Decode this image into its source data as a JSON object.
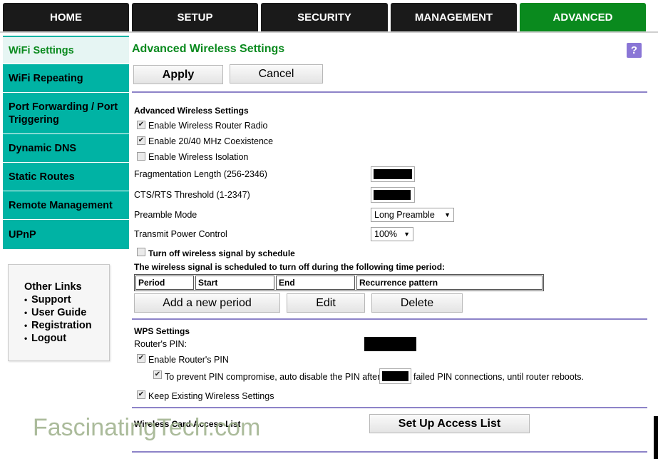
{
  "tabs": [
    {
      "label": "HOME"
    },
    {
      "label": "SETUP"
    },
    {
      "label": "SECURITY"
    },
    {
      "label": "MANAGEMENT"
    },
    {
      "label": "ADVANCED",
      "active": true
    }
  ],
  "sidebar": {
    "items": [
      {
        "label": "WiFi Settings",
        "active": true
      },
      {
        "label": "WiFi Repeating"
      },
      {
        "label": "Port Forwarding / Port Triggering"
      },
      {
        "label": "Dynamic DNS"
      },
      {
        "label": "Static Routes"
      },
      {
        "label": "Remote Management"
      },
      {
        "label": "UPnP"
      }
    ]
  },
  "other_links": {
    "title": "Other Links",
    "items": [
      "Support",
      "User Guide",
      "Registration",
      "Logout"
    ]
  },
  "main": {
    "title": "Advanced Wireless Settings",
    "help_label": "?",
    "apply_label": "Apply",
    "cancel_label": "Cancel",
    "advanced": {
      "heading": "Advanced Wireless Settings",
      "enable_radio": {
        "label": "Enable Wireless Router Radio",
        "checked": true
      },
      "coexistence": {
        "label": "Enable 20/40 MHz Coexistence",
        "checked": true
      },
      "isolation": {
        "label": "Enable Wireless Isolation",
        "checked": false
      },
      "frag_label": "Fragmentation Length (256-2346)",
      "cts_label": "CTS/RTS Threshold (1-2347)",
      "preamble_label": "Preamble Mode",
      "preamble_value": "Long Preamble",
      "power_label": "Transmit Power Control",
      "power_value": "100%"
    },
    "schedule": {
      "toggle_label": "Turn off wireless signal by schedule",
      "toggle_checked": false,
      "description": "The wireless signal is scheduled to turn off during the following time period:",
      "columns": [
        "Period",
        "Start",
        "End",
        "Recurrence pattern"
      ],
      "add_label": "Add a new period",
      "edit_label": "Edit",
      "delete_label": "Delete"
    },
    "wps": {
      "heading": "WPS Settings",
      "pin_label": "Router's PIN:",
      "enable_pin": {
        "label": "Enable Router's PIN",
        "checked": true
      },
      "prevent_before": "To prevent PIN compromise, auto disable the PIN after",
      "prevent_after": "failed PIN connections, until router reboots.",
      "prevent_checked": true,
      "keep": {
        "label": "Keep Existing Wireless Settings",
        "checked": true
      }
    },
    "access": {
      "label": "Wireless Card Access List",
      "button_label": "Set Up Access List"
    }
  },
  "watermark": "FascinatingTech.com",
  "colors": {
    "tab_bg": "#1a1a1a",
    "tab_active": "#0a8a1e",
    "sidebar_bg": "#00b3a4",
    "title_green": "#0a8a1e",
    "separator": "#8d83c8",
    "help_bg": "#8a76d6"
  }
}
